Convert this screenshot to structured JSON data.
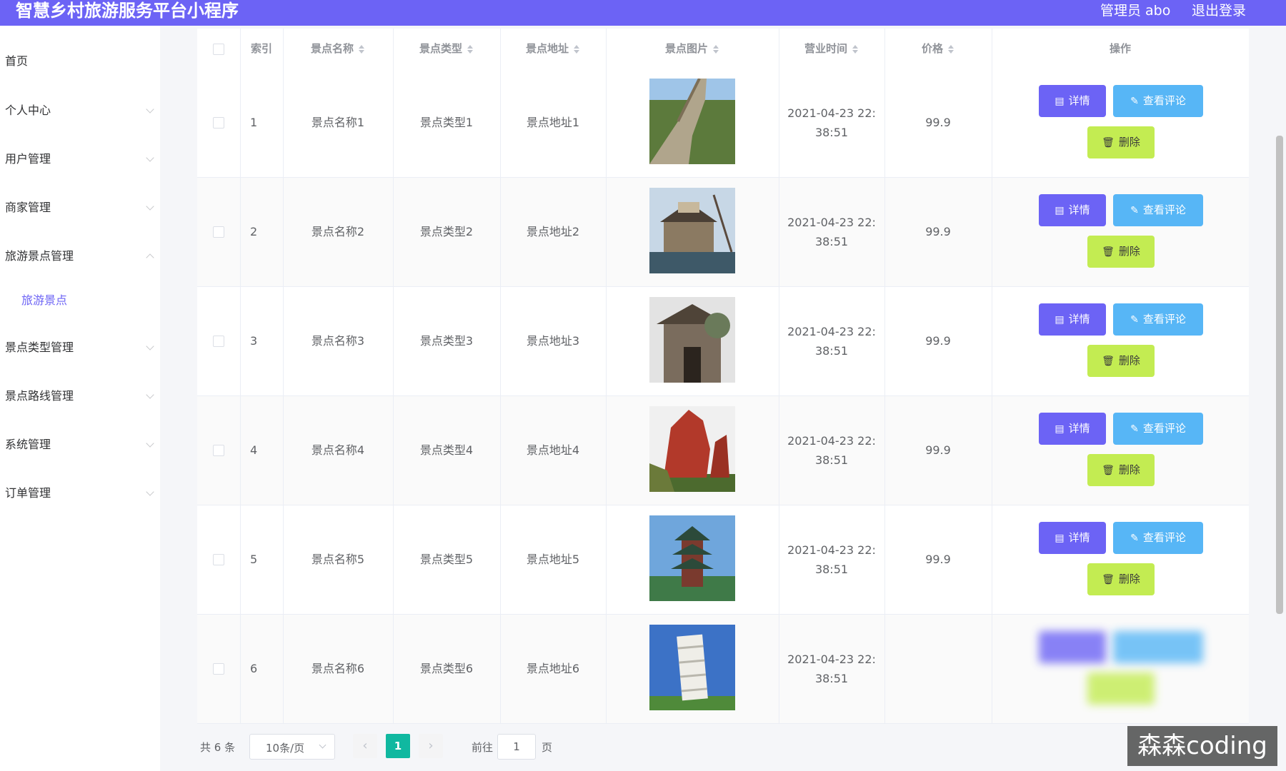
{
  "header": {
    "title": "智慧乡村旅游服务平台小程序",
    "user": "管理员 abo",
    "logout": "退出登录"
  },
  "sidebar": {
    "items": [
      {
        "label": "首页",
        "has_arrow": false
      },
      {
        "label": "个人中心",
        "has_arrow": true
      },
      {
        "label": "用户管理",
        "has_arrow": true
      },
      {
        "label": "商家管理",
        "has_arrow": true
      },
      {
        "label": "旅游景点管理",
        "has_arrow": true
      },
      {
        "label": "旅游景点",
        "sub": true
      },
      {
        "label": "景点类型管理",
        "has_arrow": true
      },
      {
        "label": "景点路线管理",
        "has_arrow": true
      },
      {
        "label": "系统管理",
        "has_arrow": true
      },
      {
        "label": "订单管理",
        "has_arrow": true
      }
    ]
  },
  "table": {
    "columns": [
      "索引",
      "景点名称",
      "景点类型",
      "景点地址",
      "景点图片",
      "营业时间",
      "价格",
      "操作"
    ],
    "rows": [
      {
        "index": "1",
        "name": "景点名称1",
        "type": "景点类型1",
        "address": "景点地址1",
        "time_line1": "2021-04-23 22:",
        "time_line2": "38:51",
        "price": "99.9",
        "image": "great-wall-photo"
      },
      {
        "index": "2",
        "name": "景点名称2",
        "type": "景点类型2",
        "address": "景点地址2",
        "time_line1": "2021-04-23 22:",
        "time_line2": "38:51",
        "price": "99.9",
        "image": "lakeside-pavilion-photo"
      },
      {
        "index": "3",
        "name": "景点名称3",
        "type": "景点类型3",
        "address": "景点地址3",
        "time_line1": "2021-04-23 22:",
        "time_line2": "38:51",
        "price": "99.9",
        "image": "stone-archway-photo"
      },
      {
        "index": "4",
        "name": "景点名称4",
        "type": "景点类型4",
        "address": "景点地址4",
        "time_line1": "2021-04-23 22:",
        "time_line2": "38:51",
        "price": "99.9",
        "image": "red-rock-photo"
      },
      {
        "index": "5",
        "name": "景点名称5",
        "type": "景点类型5",
        "address": "景点地址5",
        "time_line1": "2021-04-23 22:",
        "time_line2": "38:51",
        "price": "99.9",
        "image": "pagoda-tower-photo"
      },
      {
        "index": "6",
        "name": "景点名称6",
        "type": "景点类型6",
        "address": "景点地址6",
        "time_line1": "2021-04-23 22:",
        "time_line2": "38:51",
        "price": "",
        "image": "leaning-tower-photo"
      }
    ],
    "actions": {
      "detail": "详情",
      "review": "查看评论",
      "delete": "删除"
    }
  },
  "pagination": {
    "total": "共 6 条",
    "page_size": "10条/页",
    "current_page": "1",
    "goto_label": "前往",
    "goto_value": "1",
    "goto_suffix": "页"
  },
  "watermark": "森森coding",
  "colors": {
    "header": "#6c63f5",
    "detail_button": "#6c63f5",
    "review_button": "#57b6f6",
    "delete_button": "#c3ec52",
    "active_page": "#10b8a0"
  }
}
